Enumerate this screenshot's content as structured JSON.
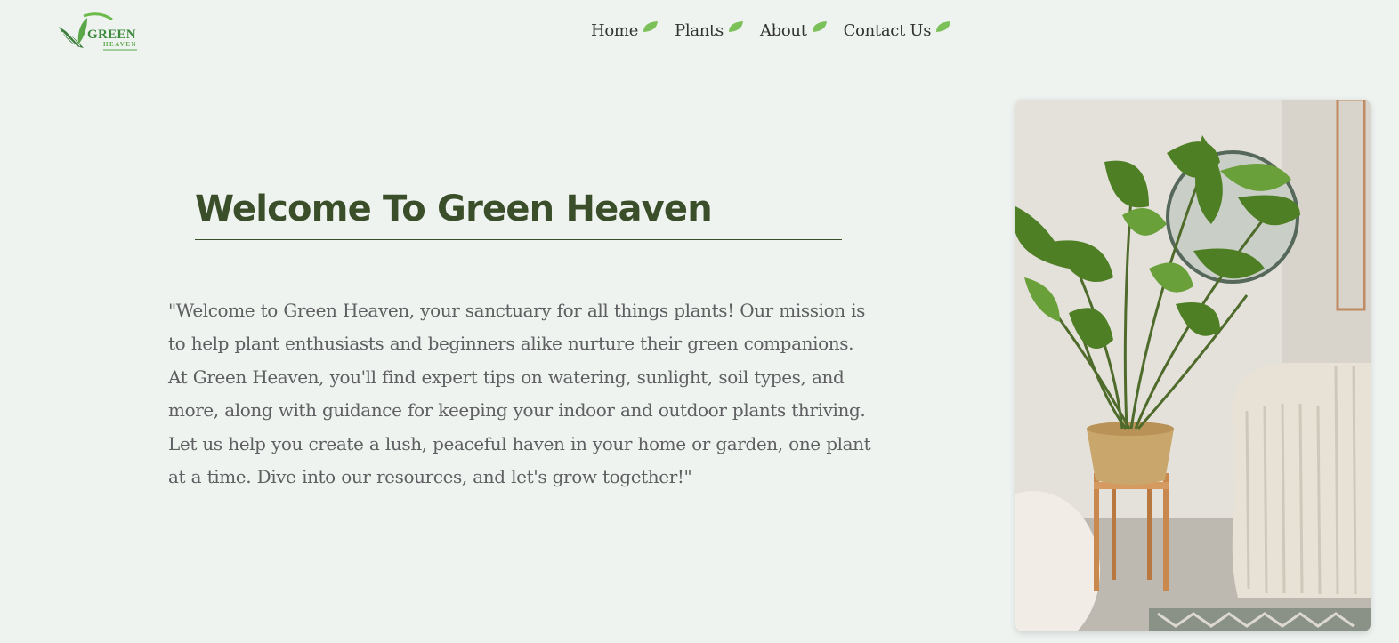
{
  "brand": {
    "logo_word": "GREEN",
    "logo_sub": "HEAVEN",
    "accent": "#3e8b3e"
  },
  "nav": {
    "items": [
      {
        "label": "Home",
        "icon": "leaf-icon"
      },
      {
        "label": "Plants",
        "icon": "leaf-icon"
      },
      {
        "label": "About",
        "icon": "leaf-icon"
      },
      {
        "label": "Contact Us",
        "icon": "leaf-icon"
      }
    ]
  },
  "hero": {
    "title": "Welcome To Green Heaven",
    "intro": "\"Welcome to Green Heaven, your sanctuary for all things plants! Our mission is to help plant enthusiasts and beginners alike nurture their green companions. At Green Heaven, you'll find expert tips on watering, sunlight, soil types, and more, along with guidance for keeping your indoor and outdoor plants thriving. Let us help you create a lush, peaceful haven in your home or garden, one plant at a time. Dive into our resources, and let's grow together!\""
  },
  "colors": {
    "background": "#eff3f0",
    "title": "#3b4e2a",
    "leaf": "#7cc05a"
  }
}
